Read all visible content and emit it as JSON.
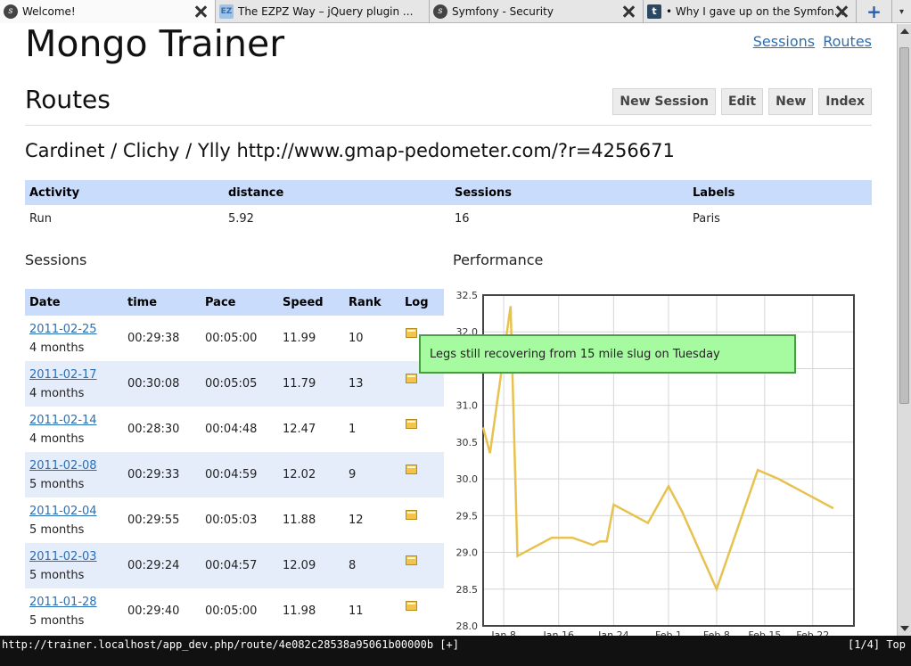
{
  "browser": {
    "tabs": [
      {
        "title": "Welcome!",
        "icon": "symfony-icon"
      },
      {
        "title": "The EZPZ Way – jQuery plugin ...",
        "icon": "ezpz-icon"
      },
      {
        "title": "Symfony - Security",
        "icon": "symfony-icon"
      },
      {
        "title": "• Why I gave up on the Symfon...",
        "icon": "tumblr-icon"
      }
    ],
    "new_tab_symbol": "+",
    "status_url": "http://trainer.localhost/app_dev.php/route/4e082c28538a95061b00000b [+]",
    "status_pos": "[1/4]  Top"
  },
  "app": {
    "title": "Mongo Trainer",
    "nav": [
      "Sessions",
      "Routes"
    ]
  },
  "page": {
    "title": "Routes",
    "actions": [
      "New Session",
      "Edit",
      "New",
      "Index"
    ],
    "route_name": "Cardinet / Clichy / Ylly http://www.gmap-pedometer.com/?r=4256671"
  },
  "summary": {
    "headers": [
      "Activity",
      "distance",
      "Sessions",
      "Labels"
    ],
    "row": [
      "Run",
      "5.92",
      "16",
      "Paris"
    ]
  },
  "sessions": {
    "heading": "Sessions",
    "headers": [
      "Date",
      "time",
      "Pace",
      "Speed",
      "Rank",
      "Log"
    ],
    "rows": [
      {
        "date": "2011-02-25",
        "ago": "4 months",
        "time": "00:29:38",
        "pace": "00:05:00",
        "speed": "11.99",
        "rank": "10"
      },
      {
        "date": "2011-02-17",
        "ago": "4 months",
        "time": "00:30:08",
        "pace": "00:05:05",
        "speed": "11.79",
        "rank": "13"
      },
      {
        "date": "2011-02-14",
        "ago": "4 months",
        "time": "00:28:30",
        "pace": "00:04:48",
        "speed": "12.47",
        "rank": "1"
      },
      {
        "date": "2011-02-08",
        "ago": "5 months",
        "time": "00:29:33",
        "pace": "00:04:59",
        "speed": "12.02",
        "rank": "9"
      },
      {
        "date": "2011-02-04",
        "ago": "5 months",
        "time": "00:29:55",
        "pace": "00:05:03",
        "speed": "11.88",
        "rank": "12"
      },
      {
        "date": "2011-02-03",
        "ago": "5 months",
        "time": "00:29:24",
        "pace": "00:04:57",
        "speed": "12.09",
        "rank": "8"
      },
      {
        "date": "2011-01-28",
        "ago": "5 months",
        "time": "00:29:40",
        "pace": "00:05:00",
        "speed": "11.98",
        "rank": "11"
      }
    ]
  },
  "performance": {
    "heading": "Performance",
    "tooltip": "Legs still recovering from 15 mile slug on Tuesday"
  },
  "chart_data": {
    "type": "line",
    "title": "",
    "xlabel": "",
    "ylabel": "",
    "ylim": [
      28.0,
      32.5
    ],
    "yticks": [
      28.0,
      28.5,
      29.0,
      29.5,
      30.0,
      30.5,
      31.0,
      31.5,
      32.0,
      32.5
    ],
    "xlim": [
      "2011-01-05",
      "2011-02-28"
    ],
    "xtick_labels": [
      "Jan 8",
      "Jan 16",
      "Jan 24",
      "Feb 1",
      "Feb 8",
      "Feb 15",
      "Feb 22"
    ],
    "xtick_dates": [
      "2011-01-08",
      "2011-01-16",
      "2011-01-24",
      "2011-02-01",
      "2011-02-08",
      "2011-02-15",
      "2011-02-22"
    ],
    "grid": true,
    "line_color": "#e8c24f",
    "series": [
      {
        "x": [
          "2011-01-05",
          "2011-01-06",
          "2011-01-09",
          "2011-01-10",
          "2011-01-15",
          "2011-01-18",
          "2011-01-21",
          "2011-01-22",
          "2011-01-23",
          "2011-01-24",
          "2011-01-29",
          "2011-02-01",
          "2011-02-03",
          "2011-02-08",
          "2011-02-14",
          "2011-02-17",
          "2011-02-25"
        ],
        "y": [
          30.7,
          30.35,
          32.35,
          28.95,
          29.2,
          29.2,
          29.1,
          29.15,
          29.15,
          29.65,
          29.4,
          29.9,
          29.55,
          28.5,
          30.12,
          30.0,
          29.6
        ]
      }
    ]
  }
}
